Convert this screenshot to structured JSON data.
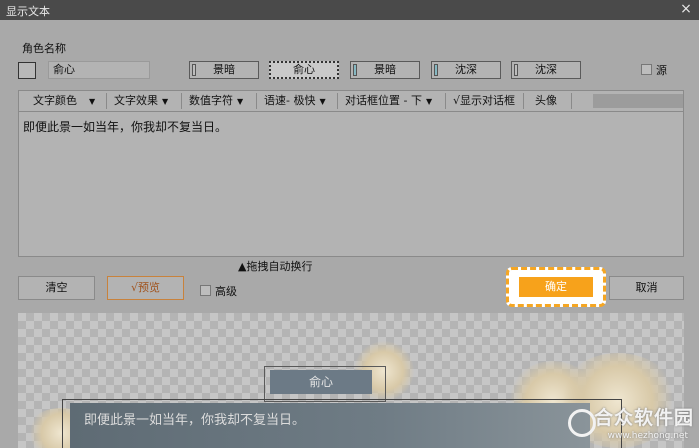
{
  "window": {
    "title": "显示文本",
    "close_icon": "×"
  },
  "role": {
    "label": "角色名称",
    "name_value": "俞心"
  },
  "characters": [
    {
      "label": "景暗",
      "marker": "gray"
    },
    {
      "label": "俞心",
      "marker": "none",
      "selected": true
    },
    {
      "label": "景暗",
      "marker": "teal"
    },
    {
      "label": "沈深",
      "marker": "teal"
    },
    {
      "label": "沈深",
      "marker": "gray"
    }
  ],
  "source": {
    "label": "源"
  },
  "toolbar": {
    "text_color": "文字颜色",
    "text_effect": "文字效果",
    "number_char": "数值字符",
    "speed": "语速- 极快",
    "dialog_pos": "对话框位置 - 下",
    "show_dialog": "√显示对话框",
    "avatar": "头像"
  },
  "editor": {
    "text": "即便此景一如当年，你我却不复当日。"
  },
  "drag_hint": "▲拖拽自动换行",
  "buttons": {
    "clear": "清空",
    "preview": "√预览",
    "advanced": "高级",
    "ok": "确定",
    "cancel": "取消"
  },
  "preview": {
    "name": "俞心",
    "line": "即便此景一如当年，你我却不复当日。"
  },
  "watermark": {
    "main": "合众软件园",
    "sub": "www.hezhong.net"
  },
  "colors": {
    "accent": "#f7a21b",
    "titlebar": "#4a4a4a",
    "teal_marker": "#86b8c2"
  }
}
